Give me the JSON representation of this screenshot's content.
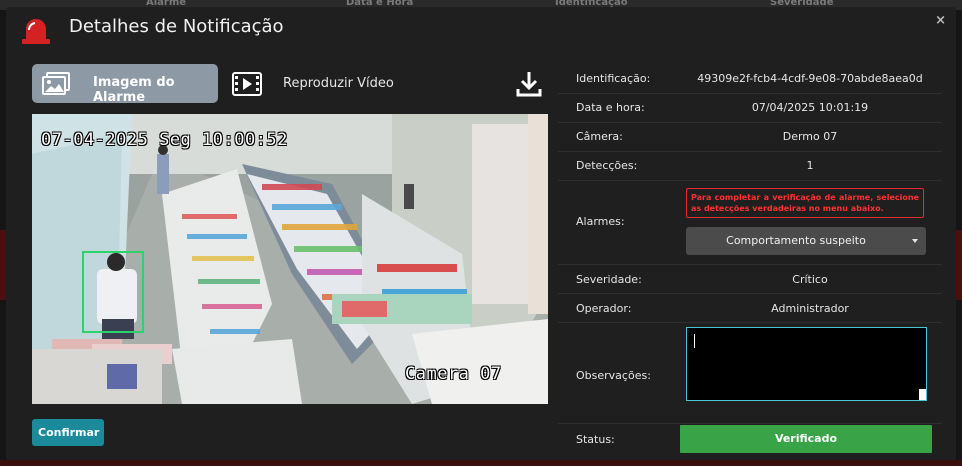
{
  "background": {
    "columns": [
      "Alarme",
      "Data e Hora",
      "Identificação",
      "Severidade"
    ]
  },
  "modal": {
    "title": "Detalhes de Notificação",
    "close_label": "×",
    "tabs": {
      "image_label": "Imagem do Alarme",
      "video_label": "Reproduzir Vídeo"
    },
    "camera_overlay": {
      "timestamp": "07-04-2025 Seg 10:00:52",
      "camera_name": "Camera 07"
    },
    "confirm_label": "Confirmar",
    "details": {
      "id_label": "Identificação:",
      "id_value": "49309e2f-fcb4-4cdf-9e08-70abde8aea0d",
      "datetime_label": "Data e hora:",
      "datetime_value": "07/04/2025 10:01:19",
      "camera_label": "Câmera:",
      "camera_value": "Dermo 07",
      "detections_label": "Detecções:",
      "detections_value": "1",
      "alarms_label": "Alarmes:",
      "alarms_warning": "Para completar a verificação de alarme, selecione as detecções verdadeiras no menu abaixo.",
      "alarms_selected": "Comportamento suspeito",
      "severity_label": "Severidade:",
      "severity_value": "Crítico",
      "operator_label": "Operador:",
      "operator_value": "Administrador",
      "notes_label": "Observações:",
      "notes_value": "",
      "status_label": "Status:",
      "status_value": "Verificado"
    }
  },
  "colors": {
    "status_green": "#38a447",
    "confirm_teal": "#1b8a9a",
    "warning_red": "#e12b2b",
    "detection_green": "#2bd36b"
  }
}
